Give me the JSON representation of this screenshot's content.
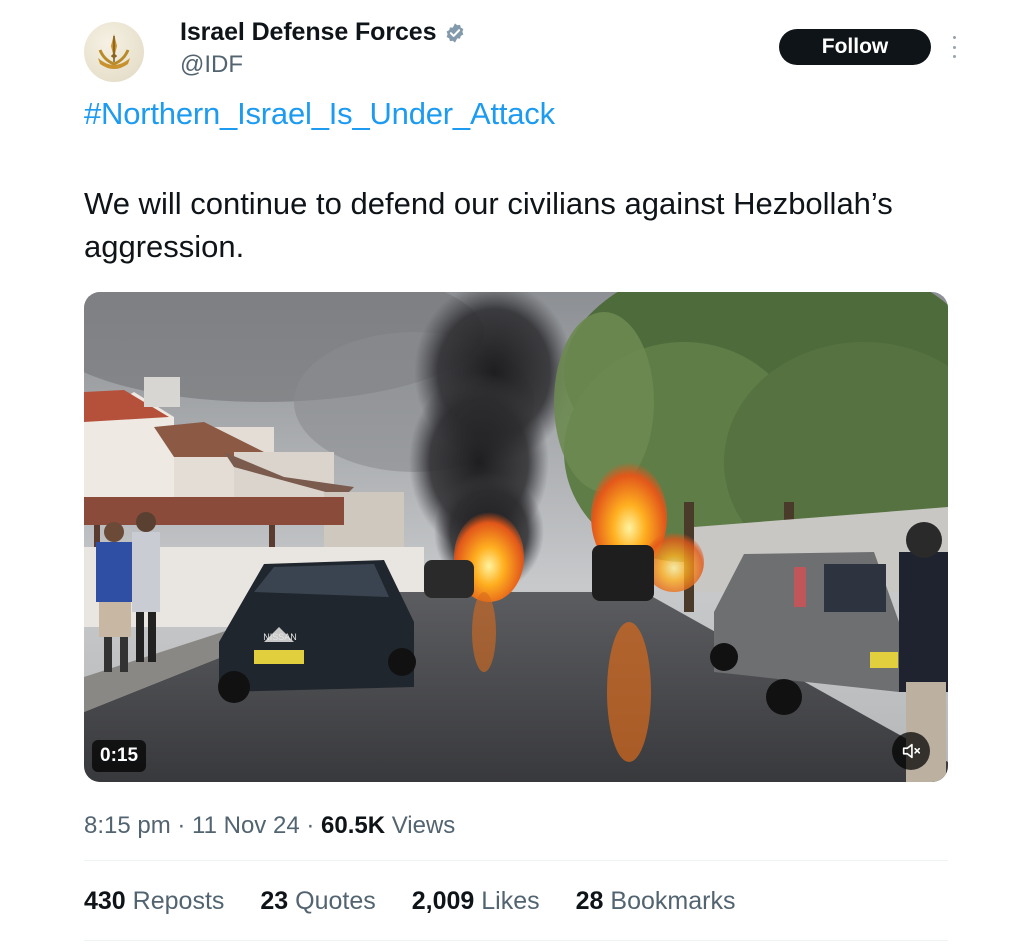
{
  "author": {
    "name": "Israel Defense Forces",
    "handle": "@IDF"
  },
  "follow_label": "Follow",
  "tweet": {
    "hashtag": "#Northern_Israel_Is_Under_Attack",
    "text": "We will continue to defend our civilians against Hezbollah’s aggression."
  },
  "media": {
    "duration": "0:15",
    "plate_text": "NISSAN"
  },
  "meta": {
    "time": "8:15 pm",
    "date": "11 Nov 24",
    "views_count": "60.5K",
    "views_label": "Views"
  },
  "stats": {
    "reposts_count": "430",
    "reposts_label": "Reposts",
    "quotes_count": "23",
    "quotes_label": "Quotes",
    "likes_count": "2,009",
    "likes_label": "Likes",
    "bookmarks_count": "28",
    "bookmarks_label": "Bookmarks"
  },
  "icons": [
    "idf-emblem-icon",
    "verified-badge-icon",
    "more-options-icon",
    "mute-icon"
  ],
  "colors": {
    "link": "#1d9bf0",
    "follow_bg": "#0f1419",
    "secondary_text": "#536471"
  }
}
